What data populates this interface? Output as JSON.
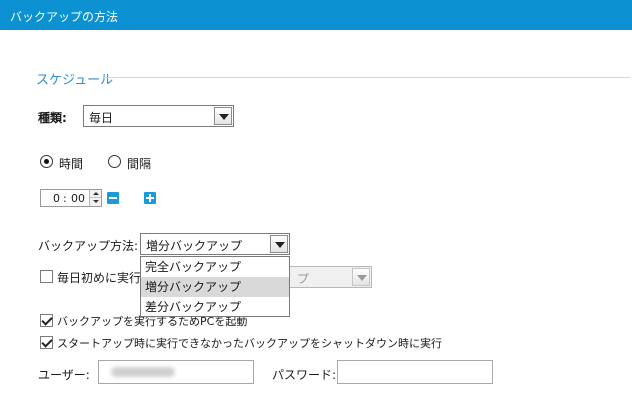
{
  "window": {
    "title": "バックアップの方法"
  },
  "schedule": {
    "section_title": "スケジュール",
    "type_label": "種類:",
    "type_value": "毎日",
    "mode_time_label": "時間",
    "mode_interval_label": "間隔",
    "mode_selected": "時間",
    "time_hour": "0",
    "time_sep": ":",
    "time_minute": "00"
  },
  "backup_method": {
    "label": "バックアップ方法:",
    "selected": "増分バックアップ",
    "options": [
      "完全バックアップ",
      "増分バックアップ",
      "差分バックアップ"
    ],
    "dropdown_open": true
  },
  "daily_first": {
    "label": "毎日初めに実行",
    "checked": false,
    "select_value_partial": "プ"
  },
  "options": {
    "start_pc_label": "バックアップを実行するためPCを起動",
    "start_pc_checked": true,
    "run_missed_label": "スタートアップ時に実行できなかったバックアップをシャットダウン時に実行",
    "run_missed_checked": true
  },
  "credentials": {
    "user_label": "ユーザー:",
    "password_label": "パスワード:"
  },
  "colors": {
    "titlebar": "#0c92d2",
    "accent": "#1b9bd9",
    "section_title": "#2f8fd0"
  }
}
